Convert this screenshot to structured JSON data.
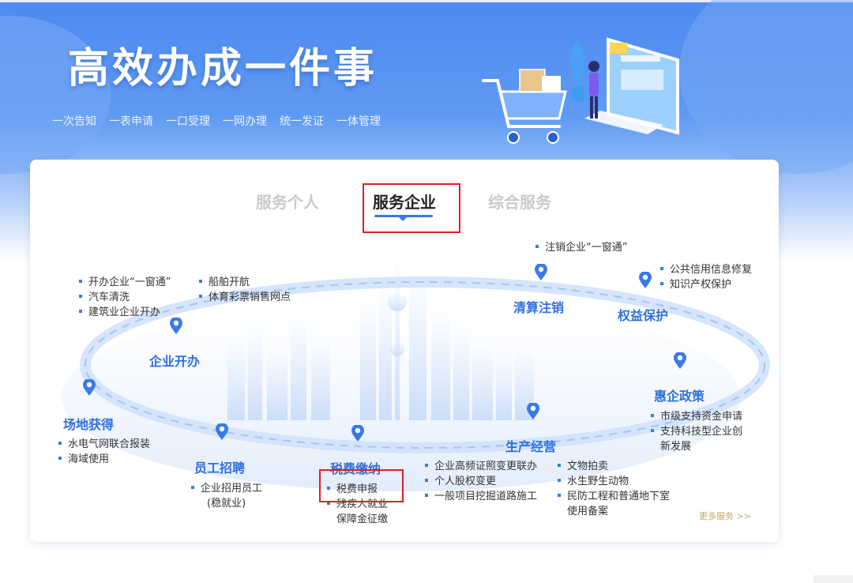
{
  "banner": {
    "title": "高效办成一件事",
    "tags": [
      "一次告知",
      "一表申请",
      "一口受理",
      "一网办理",
      "统一发证",
      "一体管理"
    ]
  },
  "tabs": [
    {
      "label": "服务个人",
      "active": false
    },
    {
      "label": "服务企业",
      "active": true
    },
    {
      "label": "综合服务",
      "active": false
    }
  ],
  "categories": {
    "site": {
      "title": "场地获得",
      "items": [
        "水电气网联合报装",
        "海域使用"
      ]
    },
    "startup": {
      "title": "企业开办",
      "items": [
        "开办企业“一窗通”",
        "汽车清洗",
        "建筑业企业开办",
        "船舶开航",
        "体育彩票销售网点"
      ]
    },
    "hiring": {
      "title": "员工招聘",
      "items": [
        "企业招用员工",
        "(稳就业)"
      ]
    },
    "tax": {
      "title": "税费缴纳",
      "items": [
        "税费申报",
        "残疾人就业",
        "保障金征缴"
      ]
    },
    "production": {
      "title": "生产经营",
      "items": [
        "企业高频证照变更联办",
        "个人股权变更",
        "一般项目挖掘道路施工",
        "文物拍卖",
        "水生野生动物",
        "民防工程和普通地下室",
        "使用备案"
      ]
    },
    "liquidation": {
      "title": "清算注销",
      "items": [
        "注销企业“一窗通”"
      ]
    },
    "rights": {
      "title": "权益保护",
      "items": [
        "公共信用信息修复",
        "知识产权保护"
      ]
    },
    "policy": {
      "title": "惠企政策",
      "items": [
        "市级支持资金申请",
        "支持科技型企业创",
        "新发展"
      ]
    }
  },
  "more_link": "更多服务 >>",
  "colors": {
    "accent": "#3a7ae6",
    "highlight": "#e31e24",
    "category": "#2f6fe0",
    "more": "#c8a36b"
  }
}
